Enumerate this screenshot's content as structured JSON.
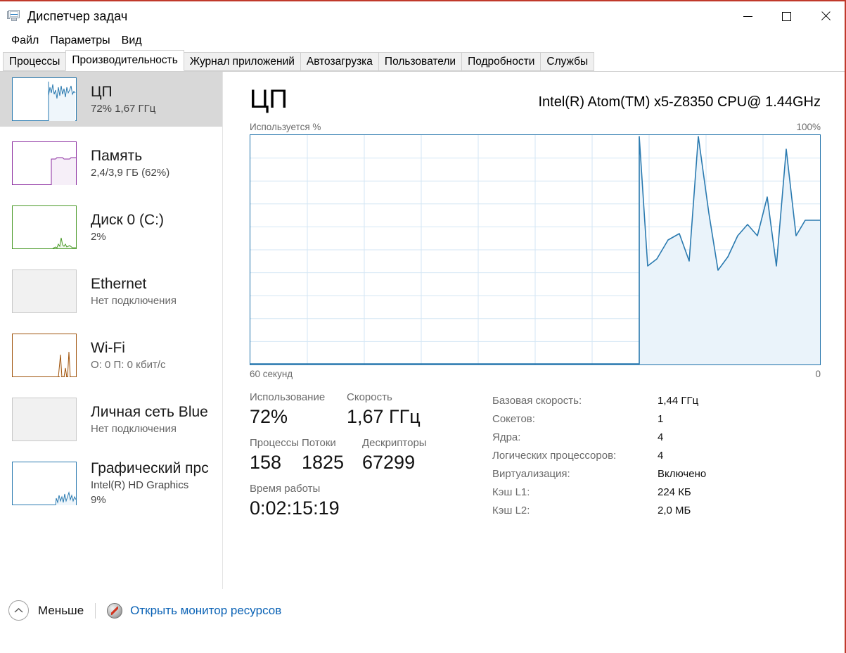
{
  "window": {
    "title": "Диспетчер задач",
    "icon": "task-manager-monitor-icon",
    "accent_border": "#c0392b",
    "minimize_label": "—",
    "maximize_label": "□",
    "close_label": "✕"
  },
  "menubar": {
    "items": [
      {
        "label": "Файл"
      },
      {
        "label": "Параметры"
      },
      {
        "label": "Вид"
      }
    ]
  },
  "tabs": {
    "active_index": 1,
    "items": [
      {
        "label": "Процессы"
      },
      {
        "label": "Производительность"
      },
      {
        "label": "Журнал приложений"
      },
      {
        "label": "Автозагрузка"
      },
      {
        "label": "Пользователи"
      },
      {
        "label": "Подробности"
      },
      {
        "label": "Службы"
      }
    ]
  },
  "sidebar": {
    "items": [
      {
        "name": "cpu",
        "title": "ЦП",
        "sub": "72%  1,67 ГГц",
        "sub2": "",
        "selected": true,
        "color": "#2a7ab0",
        "fill": "#eff6fb",
        "has_graph": true
      },
      {
        "name": "memory",
        "title": "Память",
        "sub": "2,4/3,9 ГБ (62%)",
        "sub2": "",
        "selected": false,
        "color": "#8c2ea0",
        "fill": "#f6eff8",
        "has_graph": true
      },
      {
        "name": "disk-0-c",
        "title": "Диск 0 (C:)",
        "sub": "2%",
        "sub2": "",
        "selected": false,
        "color": "#4a9a28",
        "fill": "#f1f8ed",
        "has_graph": true
      },
      {
        "name": "ethernet",
        "title": "Ethernet",
        "sub": "Нет подключения",
        "sub2": "",
        "selected": false,
        "color": "#9a9a9a",
        "fill": "#f1f1f1",
        "has_graph": false
      },
      {
        "name": "wifi",
        "title": "Wi-Fi",
        "sub": "О: 0 П: 0 кбит/с",
        "sub2": "",
        "selected": false,
        "color": "#a0540c",
        "fill": "#fbf4ed",
        "has_graph": true
      },
      {
        "name": "bluetooth-pan",
        "title": "Личная сеть Blue",
        "sub": "Нет подключения",
        "sub2": "",
        "selected": false,
        "color": "#9a9a9a",
        "fill": "#f1f1f1",
        "has_graph": false
      },
      {
        "name": "gpu",
        "title": "Графический прс",
        "sub": "Intel(R) HD Graphics",
        "sub2": "9%",
        "selected": false,
        "color": "#2a7ab0",
        "fill": "#eff6fb",
        "has_graph": true
      }
    ]
  },
  "main": {
    "title": "ЦП",
    "model": "Intel(R) Atom(TM) x5-Z8350 CPU@ 1.44GHz",
    "graph_top_label": "Используется %",
    "graph_top_right": "100%",
    "graph_bottom_left": "60 секунд",
    "graph_bottom_right": "0",
    "stats": {
      "utilization_label": "Использование",
      "utilization_value": "72%",
      "speed_label": "Скорость",
      "speed_value": "1,67 ГГц",
      "processes_label": "Процессы",
      "processes_value": "158",
      "threads_label": "Потоки",
      "threads_value": "1825",
      "handles_label": "Дескрипторы",
      "handles_value": "67299",
      "uptime_label": "Время работы",
      "uptime_value": "0:02:15:19"
    },
    "specs": [
      {
        "key": "Базовая скорость:",
        "value": "1,44 ГГц"
      },
      {
        "key": "Сокетов:",
        "value": "1"
      },
      {
        "key": "Ядра:",
        "value": "4"
      },
      {
        "key": "Логических процессоров:",
        "value": "4"
      },
      {
        "key": "Виртуализация:",
        "value": "Включено"
      },
      {
        "key": "Кэш L1:",
        "value": "224 КБ"
      },
      {
        "key": "Кэш L2:",
        "value": "2,0 МБ"
      }
    ]
  },
  "statusbar": {
    "less_label": "Меньше",
    "resource_monitor_label": "Открыть монитор ресурсов"
  },
  "chart_data": {
    "type": "area",
    "title": "Используется %",
    "xlabel": "60 секунд",
    "ylabel": "Используется %",
    "ylim": [
      0,
      100
    ],
    "xlim": [
      0,
      60
    ],
    "grid": true,
    "grid_cols": 10,
    "grid_rows": 10,
    "line_color": "#2a7ab0",
    "fill_color": "#eaf3fa",
    "series": [
      {
        "name": "CPU utilization %",
        "x": [
          0,
          41.0,
          41.4,
          42.3,
          43.8,
          45.0,
          46.2,
          47.2,
          48.2,
          48.9,
          49.5,
          50.6,
          51.6,
          52.6,
          53.6,
          54.6,
          55.4,
          56.2,
          57.0,
          57.8,
          58.6,
          59.3,
          60.0
        ],
        "values": [
          0,
          0,
          100,
          43,
          46,
          55,
          57,
          45,
          100,
          66,
          41,
          47,
          56,
          61,
          56,
          73,
          42,
          94,
          55,
          60,
          63,
          63,
          63
        ]
      }
    ]
  }
}
